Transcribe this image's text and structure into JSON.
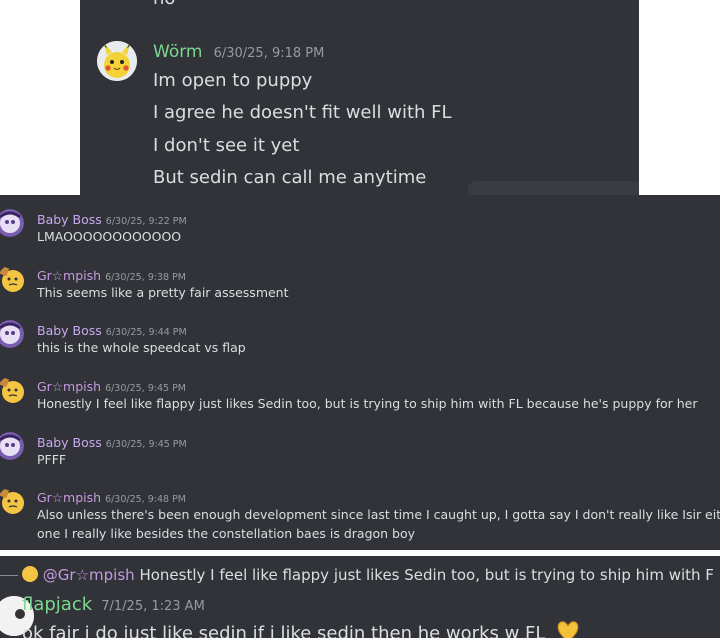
{
  "panel1": {
    "cut_text": "no",
    "author": "Wörm",
    "timestamp": "6/30/25, 9:18 PM",
    "lines": [
      "Im open to puppy",
      "I agree he doesn't fit well with FL",
      "I don't see it yet",
      "But sedin can call me anytime"
    ]
  },
  "panel2": {
    "messages": [
      {
        "author": "Baby Boss",
        "timestamp": "6/30/25, 9:22 PM",
        "text": "LMAOOOOOOOOOOOO"
      },
      {
        "author": "Gr☆mpish",
        "timestamp": "6/30/25, 9:38 PM",
        "text": "This seems like a pretty fair assessment"
      },
      {
        "author": "Baby Boss",
        "timestamp": "6/30/25, 9:44 PM",
        "text": "this is the whole speedcat vs flap"
      },
      {
        "author": "Gr☆mpish",
        "timestamp": "6/30/25, 9:45 PM",
        "text": "Honestly I feel like flappy just likes Sedin too, but is trying to ship him with FL because he's puppy for her"
      },
      {
        "author": "Baby Boss",
        "timestamp": "6/30/25, 9:45 PM",
        "text": "PFFF"
      },
      {
        "author": "Gr☆mpish",
        "timestamp": "6/30/25, 9:48 PM",
        "text": "Also unless there's been enough development since last time I caught up, I gotta say I don't really like Isir either. Only",
        "text2": "one I really like besides the constellation baes is dragon boy"
      }
    ]
  },
  "panel3": {
    "reply_author": "@Gr☆mpish",
    "reply_text": "Honestly I feel like flappy just likes Sedin too, but is trying to ship him with F",
    "author": "flapjack",
    "timestamp": "7/1/25, 1:23 AM",
    "text": "ok fair i do just like sedin if i like sedin then he works w FL"
  },
  "colors": {
    "background": "#313338",
    "worm_name": "#7ad88f",
    "flapjack_name": "#7ad88f",
    "baby_boss_name": "#c9a8f0",
    "grumpish_name": "#c49be0",
    "text": "#dbdee1",
    "timestamp": "#949ba4"
  },
  "icons": [
    "pikachu-avatar",
    "baby-boss-avatar",
    "grumpish-avatar",
    "flapjack-avatar",
    "heart-emoji-icon",
    "reply-line-icon"
  ]
}
